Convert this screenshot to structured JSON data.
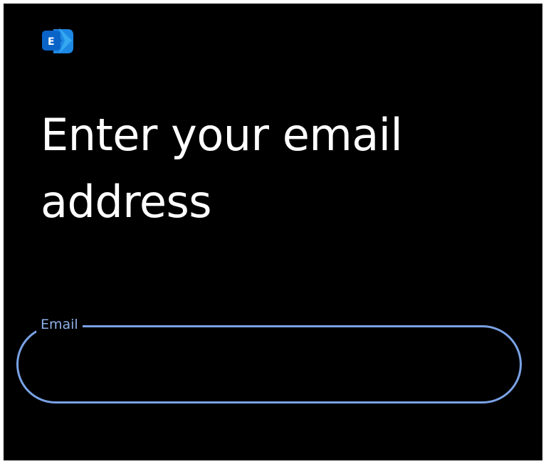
{
  "app": {
    "logo_icon": "microsoft-exchange-icon",
    "logo_letter": "E"
  },
  "page": {
    "title": "Enter your email address"
  },
  "email_field": {
    "label": "Email",
    "value": "",
    "placeholder": ""
  },
  "colors": {
    "background": "#000000",
    "field_outline": "#7aa2e6",
    "label": "#8fb0ea",
    "title_text": "#ffffff",
    "logo_dark_blue": "#0a64c8",
    "logo_light_blue": "#35a8f0"
  }
}
